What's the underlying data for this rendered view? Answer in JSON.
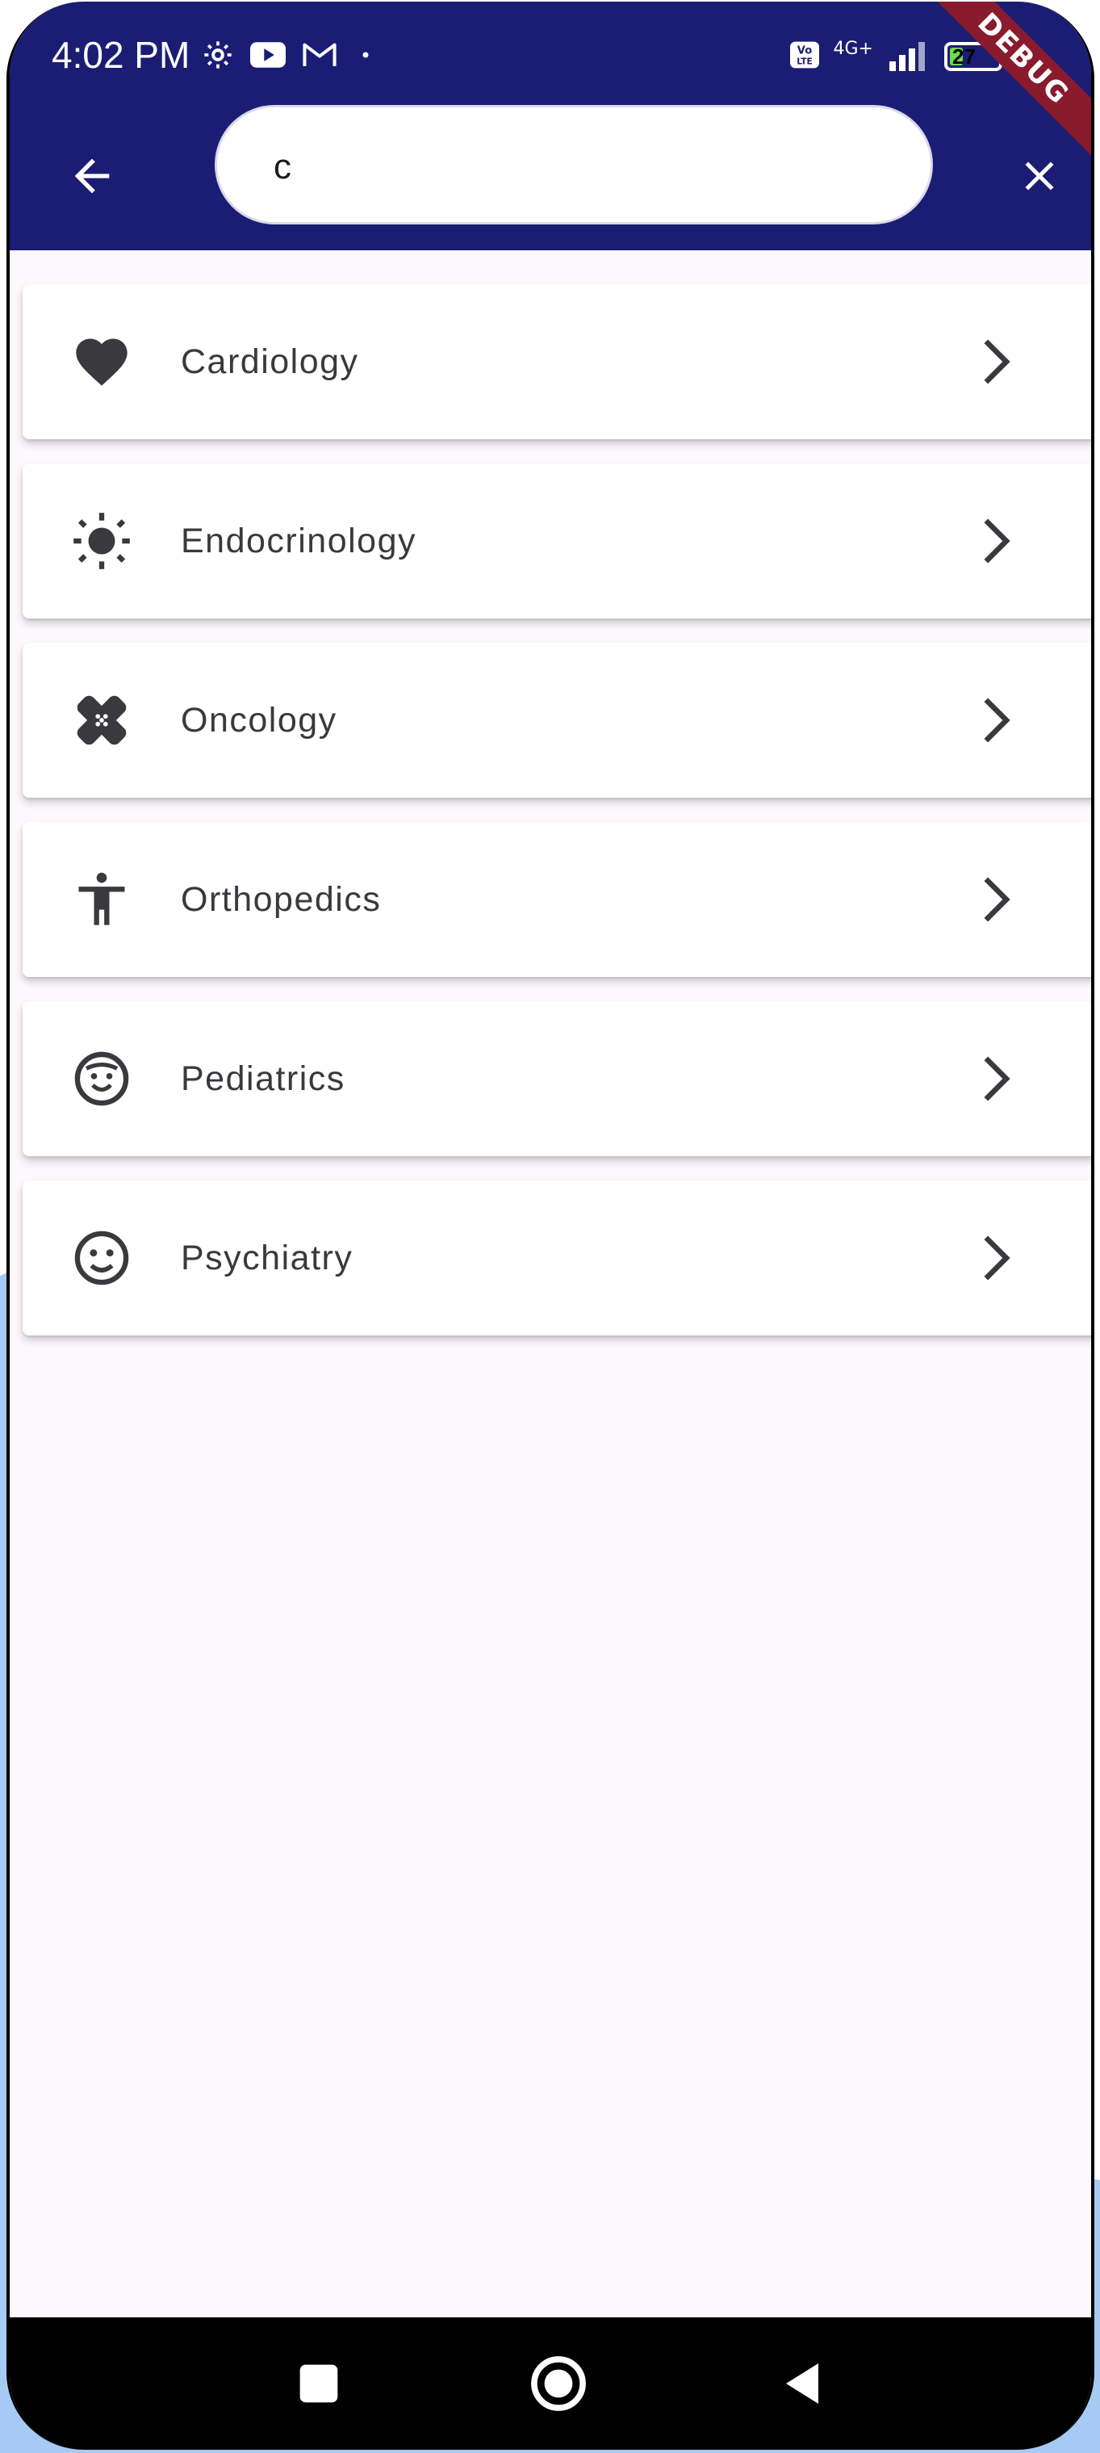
{
  "status_bar": {
    "time": "4:02 PM",
    "battery_level": "27",
    "battery_fraction": 0.27,
    "network": "4G+",
    "debug_banner": "DEBUG"
  },
  "search": {
    "query": "c",
    "placeholder": ""
  },
  "results": [
    {
      "label": "Cardiology",
      "icon": "heart-icon"
    },
    {
      "label": "Endocrinology",
      "icon": "sun-icon"
    },
    {
      "label": "Oncology",
      "icon": "bandage-icon"
    },
    {
      "label": "Orthopedics",
      "icon": "accessibility-icon"
    },
    {
      "label": "Pediatrics",
      "icon": "baby-face-icon"
    },
    {
      "label": "Psychiatry",
      "icon": "smiley-icon"
    }
  ],
  "colors": {
    "header": "#1b1d74",
    "background": "#fdf8fc",
    "text": "#3a393d",
    "icon": "#3a393d",
    "battery_fill": "#6fdc4c",
    "debug_ribbon": "#8a1a2e",
    "outer_accent": "#a6caf4"
  }
}
